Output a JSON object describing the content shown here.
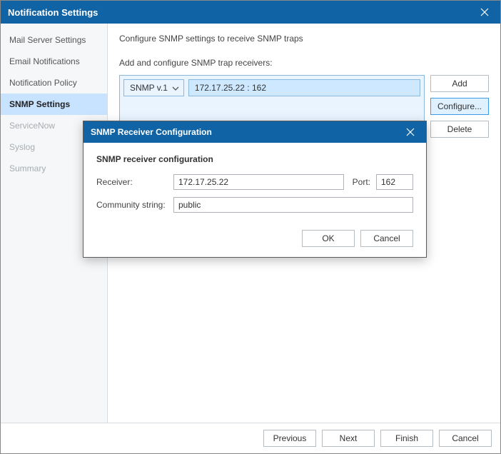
{
  "window": {
    "title": "Notification Settings"
  },
  "sidebar": {
    "items": [
      {
        "label": "Mail Server Settings",
        "state": "normal"
      },
      {
        "label": "Email Notifications",
        "state": "normal"
      },
      {
        "label": "Notification Policy",
        "state": "normal"
      },
      {
        "label": "SNMP Settings",
        "state": "active"
      },
      {
        "label": "ServiceNow",
        "state": "disabled"
      },
      {
        "label": "Syslog",
        "state": "disabled"
      },
      {
        "label": "Summary",
        "state": "disabled"
      }
    ]
  },
  "content": {
    "description": "Configure SNMP settings to receive SNMP traps",
    "section_label": "Add and configure SNMP trap receivers:",
    "receiver": {
      "protocol": "SNMP v.1",
      "display": "172.17.25.22 : 162"
    },
    "actions": {
      "add": "Add",
      "configure": "Configure...",
      "delete": "Delete"
    }
  },
  "footer": {
    "previous": "Previous",
    "next": "Next",
    "finish": "Finish",
    "cancel": "Cancel"
  },
  "modal": {
    "title": "SNMP Receiver Configuration",
    "heading": "SNMP receiver configuration",
    "labels": {
      "receiver": "Receiver:",
      "port": "Port:",
      "community": "Community string:"
    },
    "values": {
      "receiver": "172.17.25.22",
      "port": "162",
      "community": "public"
    },
    "buttons": {
      "ok": "OK",
      "cancel": "Cancel"
    }
  }
}
